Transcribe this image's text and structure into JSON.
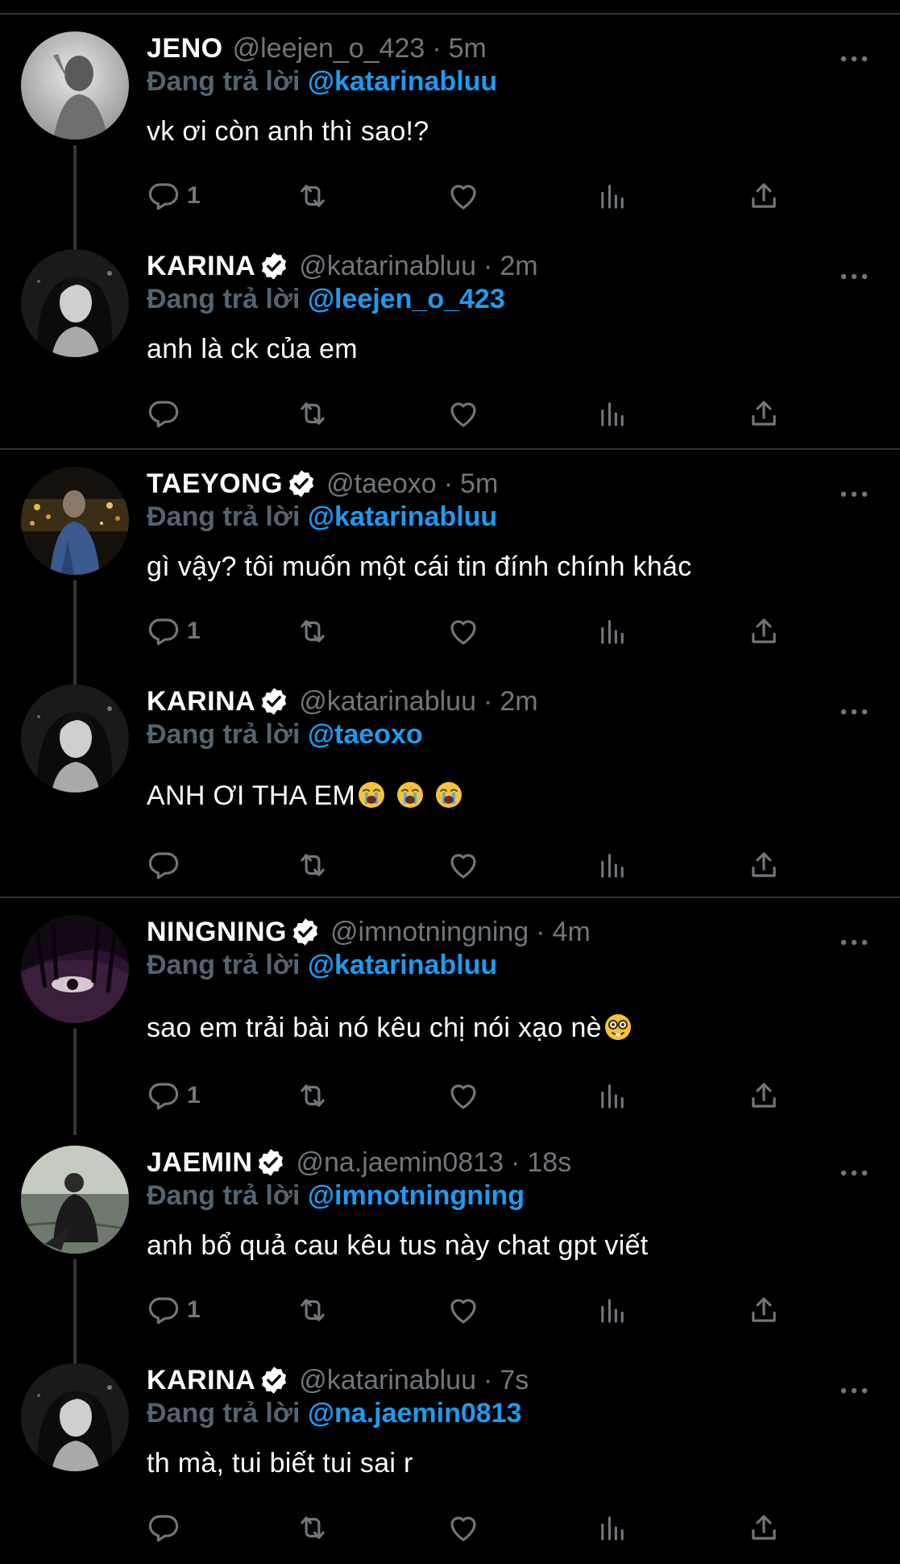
{
  "colors": {
    "background": "#000000",
    "text": "#ffffff",
    "muted": "#71767b",
    "reply_prefix": "#536471",
    "link": "#1d9bf0",
    "separator": "#2f3336"
  },
  "tweets": [
    {
      "name": "JENO",
      "verified": false,
      "handle": "@leejen_o_423",
      "time": "5m",
      "reply_prefix": "Đang trả lời",
      "reply_to": "@katarinabluu",
      "text": "vk ơi còn anh thì sao!?",
      "reply_count": "1",
      "avatar": "avatar-jeno"
    },
    {
      "name": "KARINA",
      "verified": true,
      "handle": "@katarinabluu",
      "time": "2m",
      "reply_prefix": "Đang trả lời",
      "reply_to": "@leejen_o_423",
      "text": "anh là ck của em",
      "reply_count": "",
      "avatar": "avatar-karina"
    },
    {
      "name": "TAEYONG",
      "verified": true,
      "handle": "@taeoxo",
      "time": "5m",
      "reply_prefix": "Đang trả lời",
      "reply_to": "@katarinabluu",
      "text": "gì vậy? tôi muốn một cái tin đính chính khác",
      "reply_count": "1",
      "avatar": "avatar-taeyong"
    },
    {
      "name": "KARINA",
      "verified": true,
      "handle": "@katarinabluu",
      "time": "2m",
      "reply_prefix": "Đang trả lời",
      "reply_to": "@taeoxo",
      "text": "ANH ƠI THA EM",
      "emoji": [
        "loudly-crying-face-emoji",
        "loudly-crying-face-emoji",
        "loudly-crying-face-emoji"
      ],
      "reply_count": "",
      "avatar": "avatar-karina"
    },
    {
      "name": "NINGNING",
      "verified": true,
      "handle": "@imnotningning",
      "time": "4m",
      "reply_prefix": "Đang trả lời",
      "reply_to": "@katarinabluu",
      "text": "sao em trải bài nó kêu chị nói xạo nè",
      "emoji": [
        "nerd-face-emoji"
      ],
      "reply_count": "1",
      "avatar": "avatar-ningning"
    },
    {
      "name": "JAEMIN",
      "verified": true,
      "handle": "@na.jaemin0813",
      "time": "18s",
      "reply_prefix": "Đang trả lời",
      "reply_to": "@imnotningning",
      "text": "anh bổ quả cau kêu tus này chat gpt viết",
      "reply_count": "1",
      "avatar": "avatar-jaemin"
    },
    {
      "name": "KARINA",
      "verified": true,
      "handle": "@katarinabluu",
      "time": "7s",
      "reply_prefix": "Đang trả lời",
      "reply_to": "@na.jaemin0813",
      "text": "th mà, tui biết tui sai r",
      "reply_count": "",
      "avatar": "avatar-karina"
    }
  ]
}
